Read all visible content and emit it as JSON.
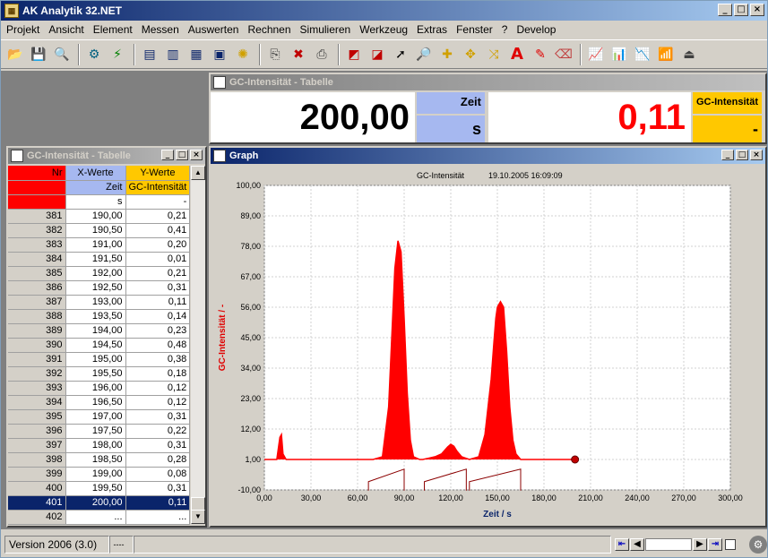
{
  "app": {
    "title": "AK Analytik 32.NET"
  },
  "menu": [
    "Projekt",
    "Ansicht",
    "Element",
    "Messen",
    "Auswerten",
    "Rechnen",
    "Simulieren",
    "Werkzeug",
    "Extras",
    "Fenster",
    "?",
    "Develop"
  ],
  "toolbar_icons": [
    "open-folder-icon",
    "save-icon",
    "search-icon",
    "connect-icon",
    "measure-icon",
    "chart-window-icon",
    "chart-window-2-icon",
    "table-icon",
    "display-icon",
    "settings-icon",
    "copy-icon",
    "delete-icon",
    "print-icon",
    "new-chart-icon",
    "edit-chart-icon",
    "pointer-icon",
    "zoom-icon",
    "cross-icon",
    "move-icon",
    "fit-icon",
    "text-icon",
    "marker-icon",
    "eraser-icon",
    "graph-1-icon",
    "graph-2-icon",
    "graph-3-icon",
    "graph-4-icon",
    "exit-icon"
  ],
  "digital_display": {
    "title": "GC-Intensität - Tabelle",
    "x_value": "200,00",
    "x_label": "Zeit",
    "x_unit": "s",
    "y_value": "0,11",
    "y_label": "GC-Intensität",
    "y_unit": "-"
  },
  "table": {
    "title": "GC-Intensität - Tabelle",
    "header": {
      "nr": "Nr",
      "x": "X-Werte",
      "y": "Y-Werte"
    },
    "labels": {
      "x": "Zeit",
      "y": "GC-Intensität"
    },
    "units": {
      "x": "s",
      "y": "-"
    },
    "rows": [
      [
        "381",
        "190,00",
        "0,21"
      ],
      [
        "382",
        "190,50",
        "0,41"
      ],
      [
        "383",
        "191,00",
        "0,20"
      ],
      [
        "384",
        "191,50",
        "0,01"
      ],
      [
        "385",
        "192,00",
        "0,21"
      ],
      [
        "386",
        "192,50",
        "0,31"
      ],
      [
        "387",
        "193,00",
        "0,11"
      ],
      [
        "388",
        "193,50",
        "0,14"
      ],
      [
        "389",
        "194,00",
        "0,23"
      ],
      [
        "390",
        "194,50",
        "0,48"
      ],
      [
        "391",
        "195,00",
        "0,38"
      ],
      [
        "392",
        "195,50",
        "0,18"
      ],
      [
        "393",
        "196,00",
        "0,12"
      ],
      [
        "394",
        "196,50",
        "0,12"
      ],
      [
        "395",
        "197,00",
        "0,31"
      ],
      [
        "396",
        "197,50",
        "0,22"
      ],
      [
        "397",
        "198,00",
        "0,31"
      ],
      [
        "398",
        "198,50",
        "0,28"
      ],
      [
        "399",
        "199,00",
        "0,08"
      ],
      [
        "400",
        "199,50",
        "0,31"
      ],
      [
        "401",
        "200,00",
        "0,11"
      ],
      [
        "402",
        "...",
        "..."
      ]
    ],
    "selected_row": "401"
  },
  "graph": {
    "title": "Graph",
    "header_label": "GC-Intensität",
    "header_timestamp": "19.10.2005 16:09:09",
    "line_color": "#ff0000"
  },
  "chart_data": {
    "type": "area",
    "xlabel": "Zeit / s",
    "ylabel": "GC-Intensität / -",
    "xlim": [
      0,
      300
    ],
    "ylim": [
      -10,
      100
    ],
    "x_ticks": [
      "0,00",
      "30,00",
      "60,00",
      "90,00",
      "120,00",
      "150,00",
      "180,00",
      "210,00",
      "240,00",
      "270,00",
      "300,00"
    ],
    "y_ticks": [
      "100,00",
      "89,00",
      "78,00",
      "67,00",
      "56,00",
      "45,00",
      "34,00",
      "23,00",
      "12,00",
      "1,00",
      "-10,00"
    ],
    "series": [
      {
        "x": [
          0,
          8,
          10,
          11,
          12,
          14,
          70,
          76,
          80,
          82,
          84,
          86,
          88,
          90,
          92,
          94,
          96,
          100,
          102,
          106,
          110,
          114,
          118,
          120,
          122,
          124,
          127,
          132,
          138,
          142,
          146,
          148,
          149,
          150,
          152,
          154,
          156,
          158,
          160,
          162,
          165,
          175,
          200
        ],
        "y": [
          1,
          1,
          9,
          10,
          3,
          1,
          1,
          2,
          20,
          45,
          70,
          80,
          76,
          52,
          25,
          8,
          2,
          1,
          1,
          1.5,
          2,
          3,
          5.5,
          6.5,
          5.8,
          4,
          2,
          1,
          2,
          10,
          30,
          45,
          52,
          56,
          58,
          56,
          40,
          20,
          8,
          3,
          1,
          1,
          1
        ]
      }
    ],
    "integration_ranges": [
      [
        67,
        90
      ],
      [
        103,
        130
      ],
      [
        132,
        165
      ]
    ],
    "end_marker": {
      "x": 200,
      "y": 1
    }
  },
  "status": {
    "version": "Version 2006  (3.0)",
    "cell2": "----"
  }
}
